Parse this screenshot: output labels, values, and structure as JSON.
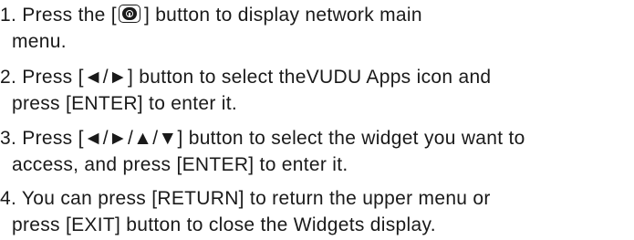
{
  "steps": [
    {
      "number": "1.",
      "line1_before_icon": " Press the  [",
      "icon": "network-home-button-icon",
      "line1_after_icon": "] button to display network main",
      "line2": "menu."
    },
    {
      "number": "2.",
      "line1": " Press [◄/►] button to select theVUDU Apps icon and",
      "line2": "press [ENTER] to enter it."
    },
    {
      "number": "3.",
      "line1": " Press [◄/►/▲/▼] button to select the widget you want to",
      "line2": "access, and press [ENTER] to enter it."
    },
    {
      "number": "4.",
      "line1": " You can press [RETURN] to return the upper menu or",
      "line2": "press [EXIT] button to close the Widgets display."
    }
  ]
}
